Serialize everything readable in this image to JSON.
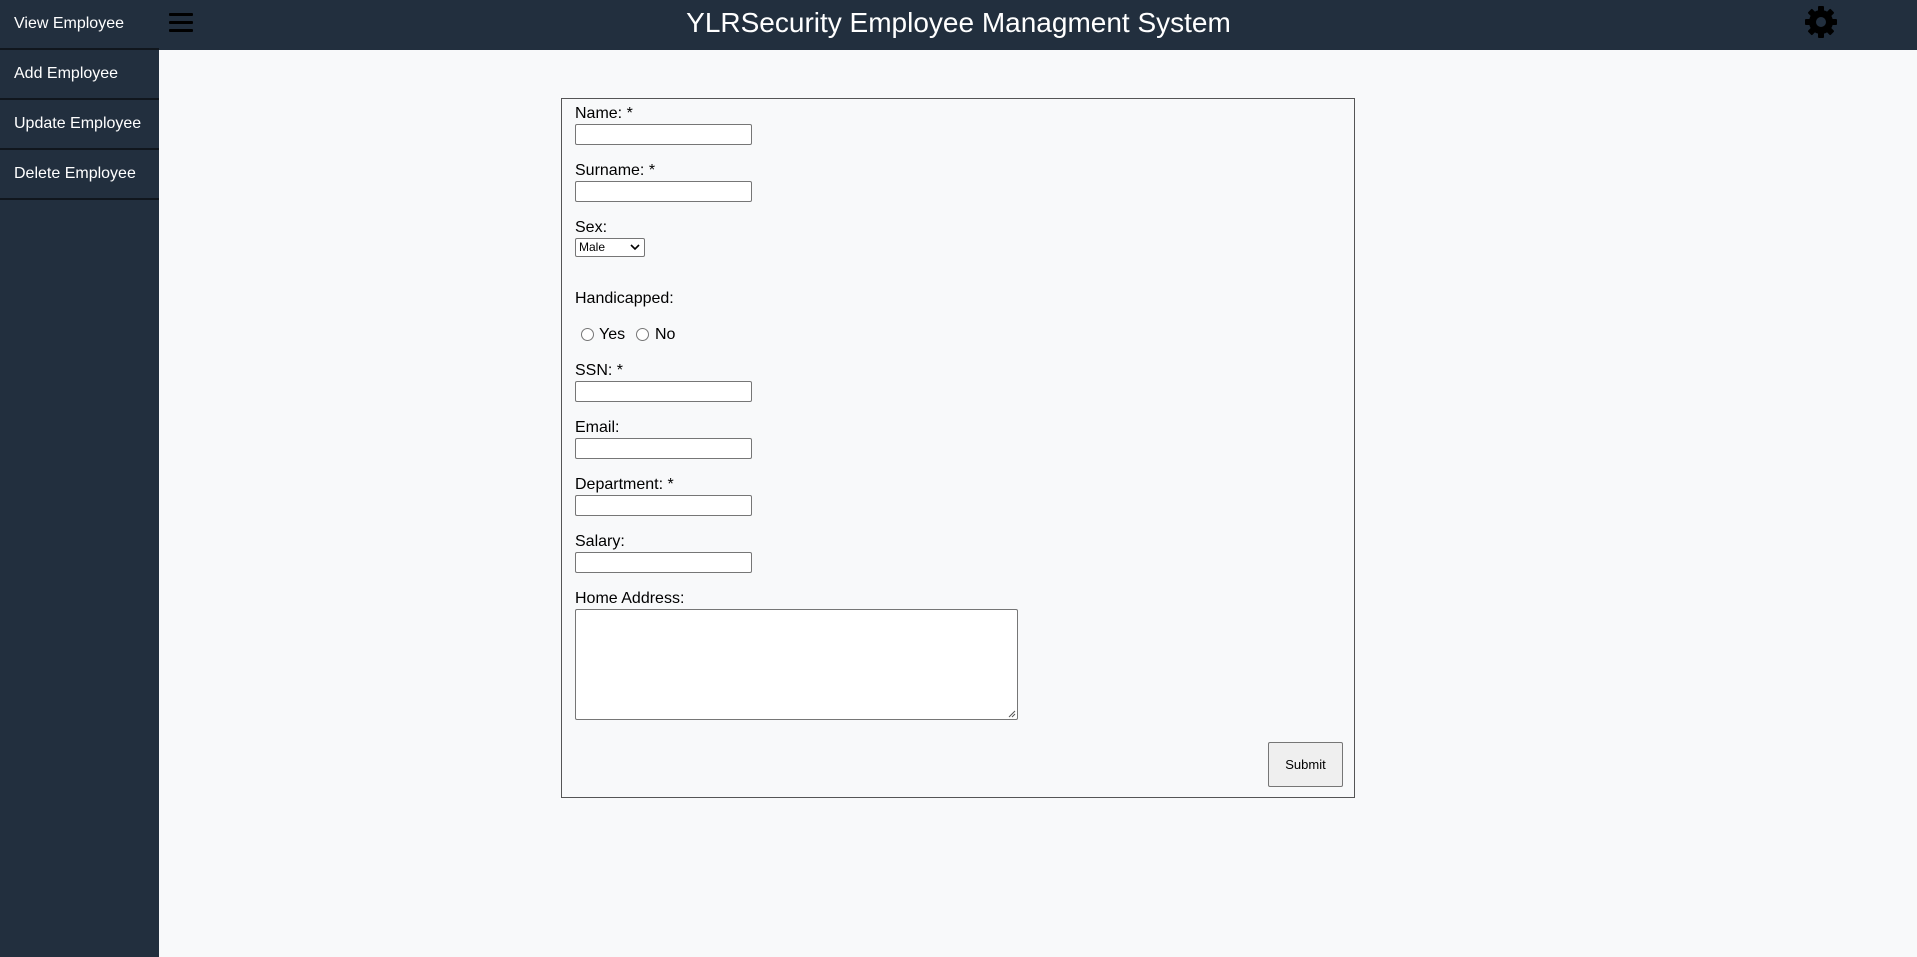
{
  "app": {
    "title": "YLRSecurity Employee Managment System"
  },
  "sidebar": {
    "items": [
      {
        "label": "View Employee"
      },
      {
        "label": "Add Employee"
      },
      {
        "label": "Update Employee"
      },
      {
        "label": "Delete Employee"
      }
    ]
  },
  "icons": {
    "menu": "hamburger-icon",
    "settings": "gear-icon"
  },
  "form": {
    "name_label": "Name: *",
    "name_value": "",
    "surname_label": "Surname: *",
    "surname_value": "",
    "sex_label": "Sex:",
    "sex_selected": "Male",
    "handicapped_label": "Handicapped:",
    "handicapped_yes": "Yes",
    "handicapped_no": "No",
    "ssn_label": "SSN: *",
    "ssn_value": "",
    "email_label": "Email:",
    "email_value": "",
    "department_label": "Department: *",
    "department_value": "",
    "salary_label": "Salary:",
    "salary_value": "",
    "address_label": "Home Address:",
    "address_value": "",
    "submit_label": "Submit"
  },
  "colors": {
    "header_bg": "#222f3e",
    "page_bg": "#f8f9fa"
  }
}
